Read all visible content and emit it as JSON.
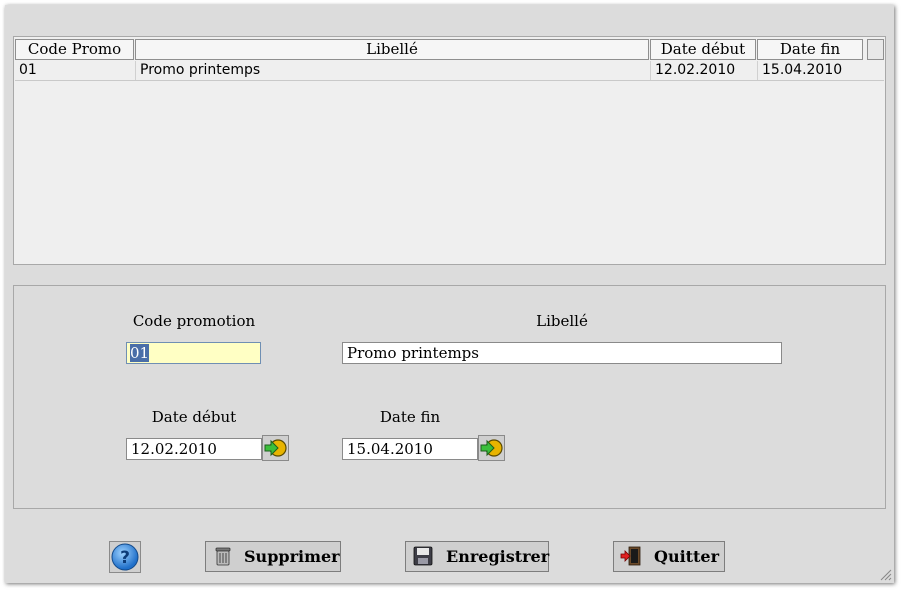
{
  "grid": {
    "columns": [
      "Code Promo",
      "Libellé",
      "Date début",
      "Date fin"
    ],
    "rows": [
      {
        "code": "01",
        "libelle": "Promo printemps",
        "date_debut": "12.02.2010",
        "date_fin": "15.04.2010"
      }
    ]
  },
  "form": {
    "code_label": "Code promotion",
    "code_value": "01",
    "libelle_label": "Libellé",
    "libelle_value": "Promo printemps",
    "date_debut_label": "Date début",
    "date_debut_value": "12.02.2010",
    "date_fin_label": "Date fin",
    "date_fin_value": "15.04.2010"
  },
  "buttons": {
    "help_icon": "help-icon",
    "supprimer": "Supprimer",
    "enregistrer": "Enregistrer",
    "quitter": "Quitter"
  }
}
